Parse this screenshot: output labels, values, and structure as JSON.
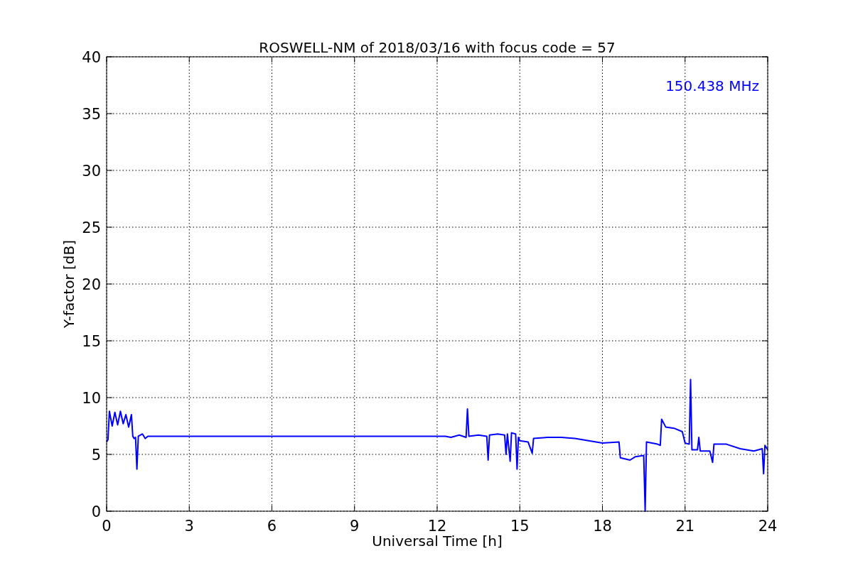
{
  "chart_data": {
    "type": "line",
    "title": "ROSWELL-NM of 2018/03/16 with focus code = 57",
    "xlabel": "Universal Time [h]",
    "ylabel": "Y-factor [dB]",
    "x": [
      0.0,
      0.05,
      0.1,
      0.2,
      0.3,
      0.4,
      0.5,
      0.6,
      0.7,
      0.8,
      0.9,
      0.95,
      1.0,
      1.05,
      1.1,
      1.15,
      1.3,
      1.4,
      1.5,
      12.3,
      12.5,
      12.8,
      13.05,
      13.1,
      13.15,
      13.5,
      13.8,
      13.85,
      13.9,
      14.2,
      14.45,
      14.5,
      14.55,
      14.65,
      14.7,
      14.85,
      14.9,
      14.95,
      15.0,
      15.3,
      15.45,
      15.5,
      16.0,
      16.5,
      17.0,
      17.5,
      18.0,
      18.6,
      18.65,
      19.0,
      19.2,
      19.5,
      19.55,
      19.6,
      20.0,
      20.1,
      20.15,
      20.3,
      20.6,
      20.9,
      21.0,
      21.15,
      21.2,
      21.25,
      21.45,
      21.5,
      21.55,
      21.9,
      22.0,
      22.05,
      22.5,
      23.0,
      23.5,
      23.8,
      23.85,
      23.9,
      24.0
    ],
    "series": [
      {
        "name": "150.438 MHz",
        "color": "#0000ff",
        "values": [
          6.1,
          6.3,
          8.8,
          7.5,
          8.7,
          7.6,
          8.8,
          7.7,
          8.5,
          7.4,
          8.5,
          6.6,
          6.4,
          6.5,
          3.7,
          6.6,
          6.8,
          6.4,
          6.6,
          6.6,
          6.5,
          6.7,
          6.5,
          9.0,
          6.6,
          6.7,
          6.6,
          4.5,
          6.7,
          6.8,
          6.7,
          5.0,
          6.8,
          4.4,
          6.9,
          6.8,
          3.7,
          6.5,
          6.2,
          6.1,
          5.1,
          6.4,
          6.5,
          6.5,
          6.4,
          6.2,
          6.0,
          6.1,
          4.7,
          4.5,
          4.8,
          4.9,
          0.0,
          6.1,
          5.9,
          5.8,
          8.1,
          7.4,
          7.3,
          7.0,
          6.0,
          5.9,
          11.6,
          5.4,
          5.4,
          6.5,
          5.3,
          5.3,
          4.3,
          5.9,
          5.9,
          5.5,
          5.3,
          5.5,
          3.3,
          5.8,
          5.4
        ]
      }
    ],
    "xlim": [
      0,
      24
    ],
    "ylim": [
      0,
      40
    ],
    "xticks": [
      0,
      3,
      6,
      9,
      12,
      15,
      18,
      21,
      24
    ],
    "yticks": [
      0,
      5,
      10,
      15,
      20,
      25,
      30,
      35,
      40
    ],
    "grid": true
  }
}
